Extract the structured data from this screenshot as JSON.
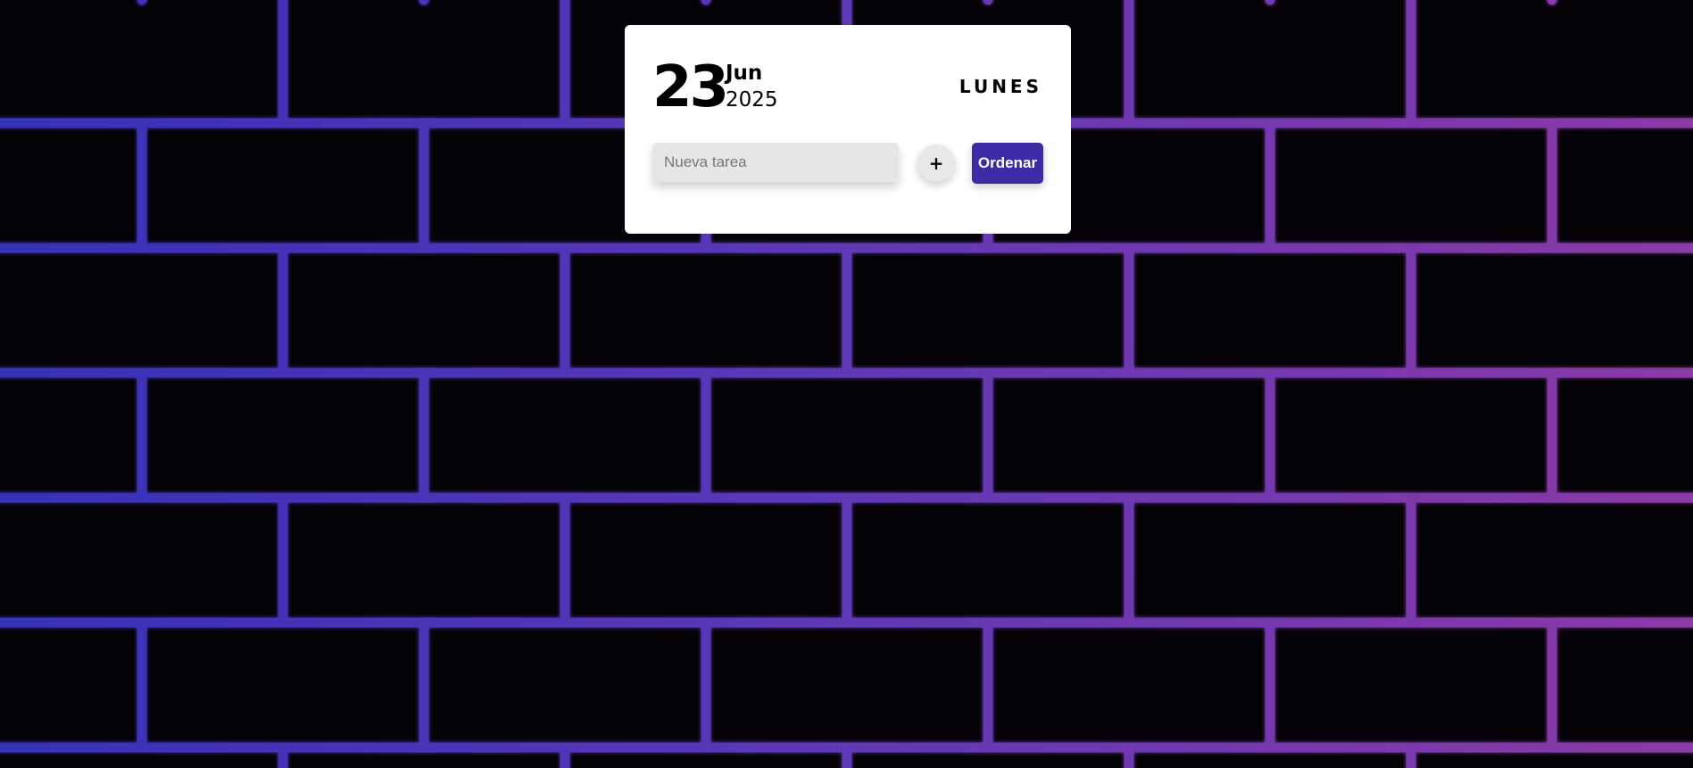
{
  "card": {
    "day": "23",
    "month": "Jun",
    "year": "2025",
    "weekday": "LUNES"
  },
  "task_input": {
    "value": "",
    "placeholder": "Nueva tarea"
  },
  "add_button": {
    "label": "+"
  },
  "sort_button": {
    "label": "Ordenar"
  },
  "colors": {
    "background": "#050307",
    "neon_left": "#3b35c4",
    "neon_right": "#8a3aa8",
    "card": "#ffffff",
    "button_primary": "#3a2ba6"
  }
}
